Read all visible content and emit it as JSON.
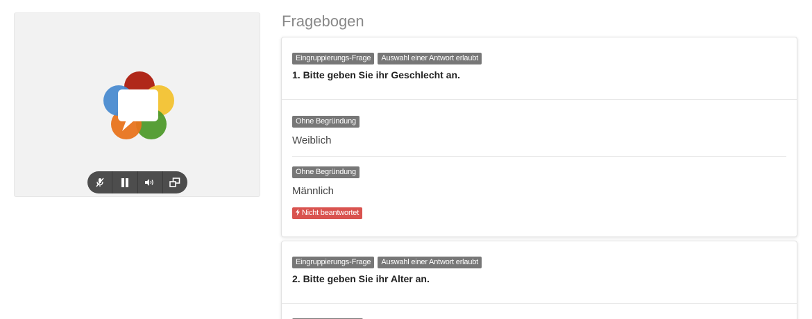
{
  "video": {
    "logo_icon": "webrtc-logo",
    "controls": [
      {
        "icon": "mic-muted-icon"
      },
      {
        "icon": "pause-icon"
      },
      {
        "icon": "volume-icon"
      },
      {
        "icon": "popout-window-icon"
      }
    ]
  },
  "questionnaire": {
    "title": "Fragebogen",
    "questions": [
      {
        "tags": [
          "Eingruppierungs-Frage",
          "Auswahl einer Antwort erlaubt"
        ],
        "text": "1. Bitte geben Sie ihr Geschlecht an.",
        "options": [
          {
            "tag": "Ohne Begründung",
            "label": "Weiblich"
          },
          {
            "tag": "Ohne Begründung",
            "label": "Männlich"
          }
        ],
        "status": "Nicht beantwortet"
      },
      {
        "tags": [
          "Eingruppierungs-Frage",
          "Auswahl einer Antwort erlaubt"
        ],
        "text": "2. Bitte geben Sie ihr Alter an."
      }
    ]
  },
  "colors": {
    "badge_grey": "#777777",
    "badge_red": "#d9534f",
    "logo_red": "#b0281a",
    "logo_yellow": "#f2c230",
    "logo_green": "#4f9a2c",
    "logo_orange": "#e8741e",
    "logo_blue": "#4a8bd0"
  }
}
